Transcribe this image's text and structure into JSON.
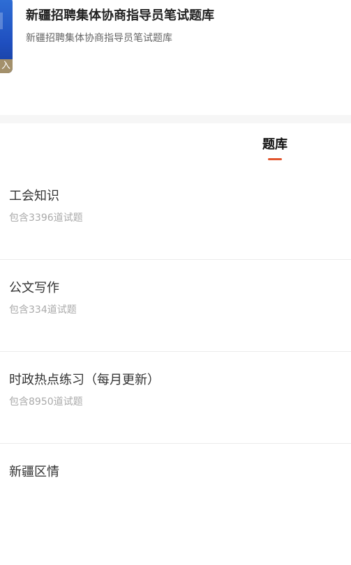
{
  "header": {
    "title": "新疆招聘集体协商指导员笔试题库",
    "subtitle": "新疆招聘集体协商指导员笔试题库",
    "cover_tag": "入",
    "cover_color": "#1f4fbf"
  },
  "tabs": [
    {
      "label": "题库",
      "active": true
    }
  ],
  "accent_color": "#e2562e",
  "question_banks": [
    {
      "name": "工会知识",
      "count": "包含3396道试题"
    },
    {
      "name": "公文写作",
      "count": "包含334道试题"
    },
    {
      "name": "时政热点练习（每月更新）",
      "count": "包含8950道试题"
    },
    {
      "name": "新疆区情",
      "count": ""
    }
  ]
}
